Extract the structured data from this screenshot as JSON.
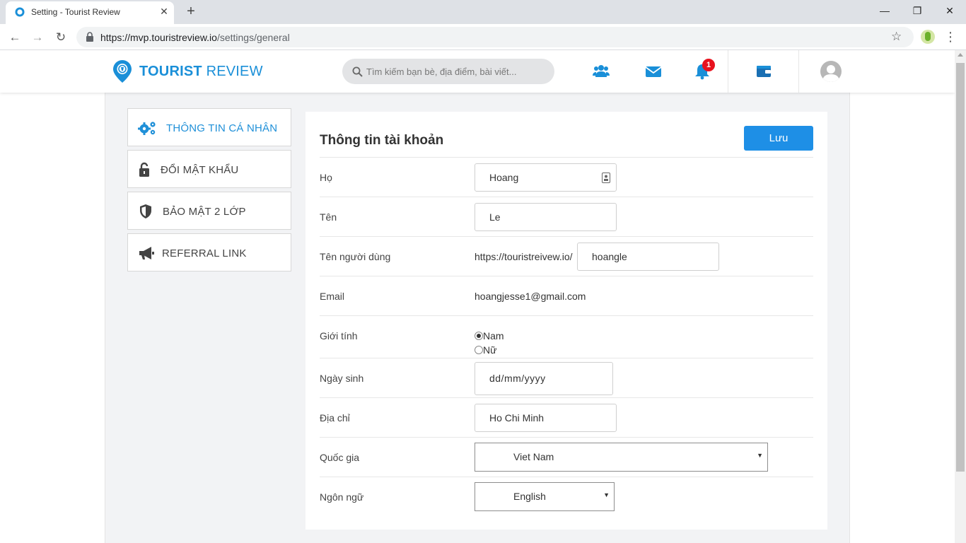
{
  "browser": {
    "tab_title": "Setting - Tourist Review",
    "tab_close": "✕",
    "new_tab": "+",
    "url_host": "https://mvp.touristreview.io",
    "url_path": "/settings/general",
    "minimize": "—",
    "restore": "❐",
    "close": "✕",
    "back": "←",
    "forward": "→",
    "reload": "↻",
    "star": "☆",
    "menu": "⋮"
  },
  "header": {
    "logo_bold": "TOURIST",
    "logo_light": " REVIEW",
    "search_placeholder": "Tìm kiếm bạn bè, địa điểm, bài viết...",
    "notification_count": "1",
    "icons": [
      "friends-icon",
      "mail-icon",
      "bell-icon",
      "wallet-icon",
      "avatar"
    ],
    "accent_color": "#1a8fd8"
  },
  "sidebar": {
    "items": [
      {
        "label": "THÔNG TIN CÁ NHÂN",
        "icon": "gears-icon",
        "active": true
      },
      {
        "label": "ĐỔI MẬT KHẨU",
        "icon": "unlock-icon",
        "active": false
      },
      {
        "label": "BẢO MẬT 2 LỚP",
        "icon": "shield-icon",
        "active": false
      },
      {
        "label": "REFERRAL LINK",
        "icon": "megaphone-icon",
        "active": false
      }
    ]
  },
  "form": {
    "title": "Thông tin tài khoản",
    "save_label": "Lưu",
    "last_name_label": "Họ",
    "last_name_value": "Hoang",
    "first_name_label": "Tên",
    "first_name_value": "Le",
    "username_label": "Tên người dùng",
    "username_prefix": "https://touristreivew.io/",
    "username_value": "hoangle",
    "email_label": "Email",
    "email_value": "hoangjesse1@gmail.com",
    "gender_label": "Giới tính",
    "gender_options": [
      "Nam",
      "Nữ"
    ],
    "gender_selected": "Nam",
    "birthday_label": "Ngày sinh",
    "birthday_placeholder": "dd/mm/yyyy",
    "address_label": "Địa chỉ",
    "address_value": "Ho Chi Minh",
    "country_label": "Quốc gia",
    "country_value": "Viet Nam",
    "language_label": "Ngôn ngữ",
    "language_value": "English",
    "caret": "▼"
  }
}
